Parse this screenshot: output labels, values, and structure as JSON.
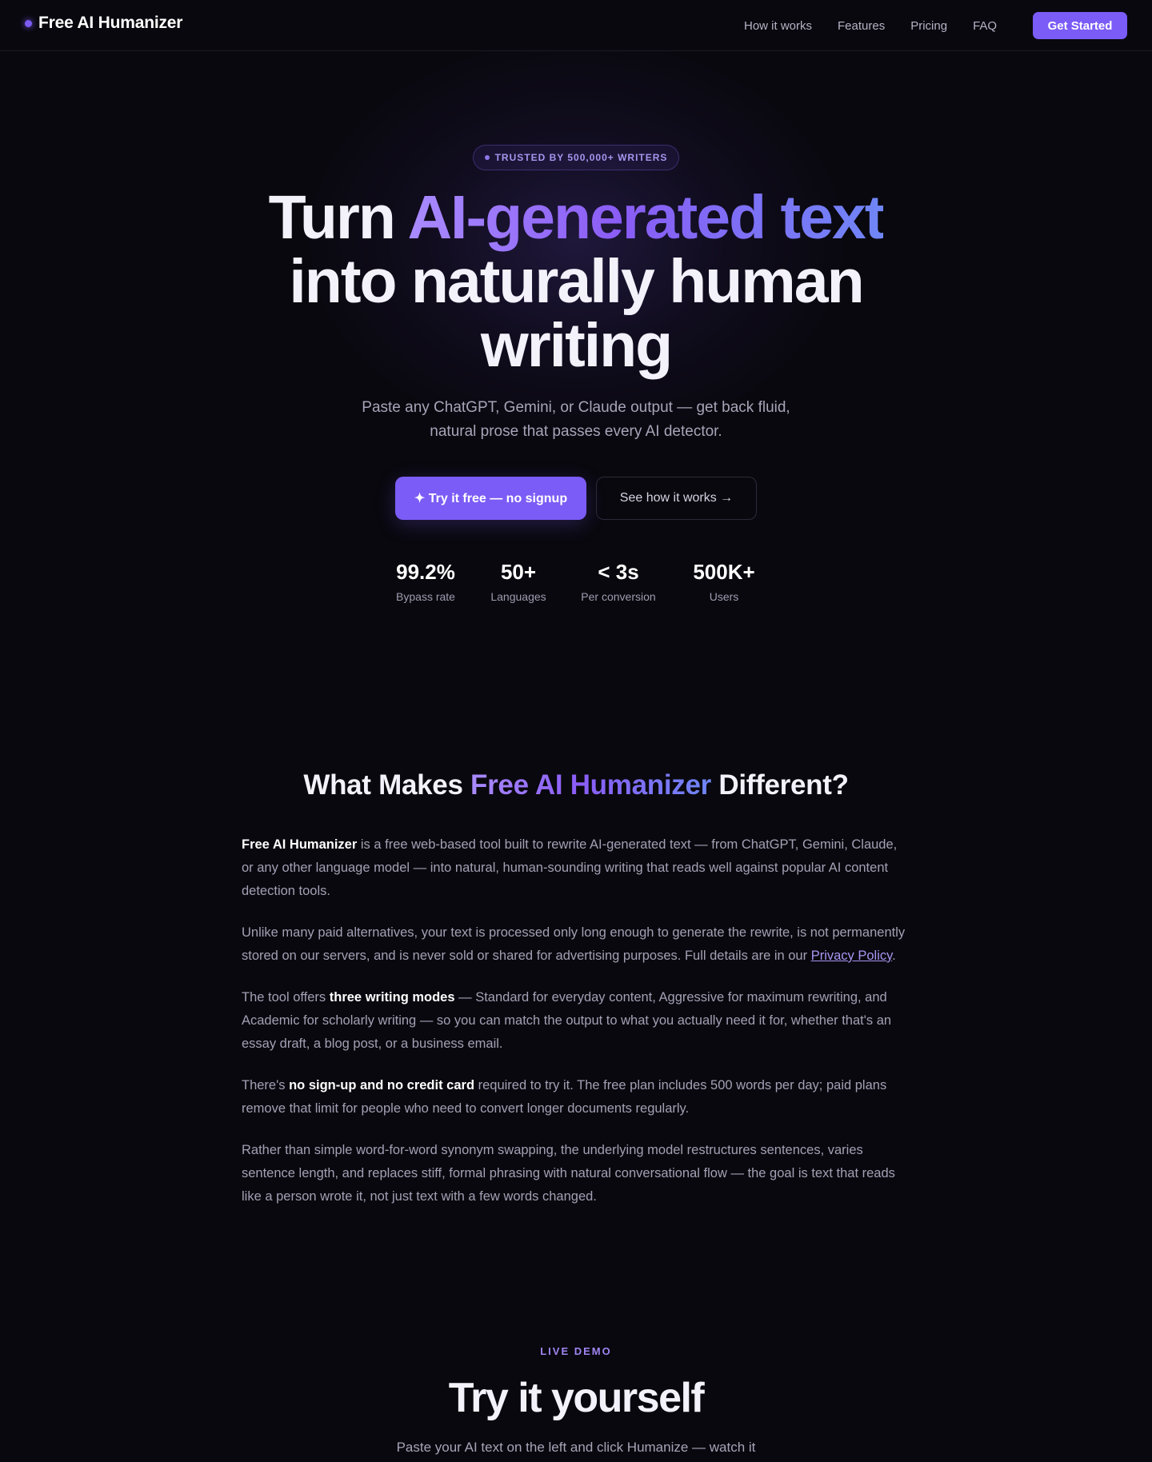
{
  "nav": {
    "brand": "Free AI Humanizer",
    "links": [
      "How it works",
      "Features",
      "Pricing",
      "FAQ"
    ],
    "cta": "Get Started"
  },
  "hero": {
    "badge": "TRUSTED BY 500,000+ WRITERS",
    "title_pre": "Turn ",
    "title_highlight": "AI-generated text",
    "title_line2": "into naturally human",
    "title_line3": "writing",
    "subtitle_line1": "Paste any ChatGPT, Gemini, or Claude output — get back fluid,",
    "subtitle_line2": "natural prose that passes every AI detector.",
    "primary_cta": "✦ Try it free — no signup",
    "secondary_cta": "See how it works →",
    "stats": [
      {
        "value": "99.2%",
        "label": "Bypass rate"
      },
      {
        "value": "50+",
        "label": "Languages"
      },
      {
        "value": "< 3s",
        "label": "Per conversion"
      },
      {
        "value": "500K+",
        "label": "Users"
      }
    ]
  },
  "about": {
    "title_pre": "What Makes ",
    "title_highlight": "Free AI Humanizer",
    "title_post": " Different?",
    "p1_bold": "Free AI Humanizer",
    "p1_rest": " is a free web-based tool built to rewrite AI-generated text — from ChatGPT, Gemini, Claude, or any other language model — into natural, human-sounding writing that reads well against popular AI content detection tools.",
    "p2_text": "Unlike many paid alternatives, your text is processed only long enough to generate the rewrite, is not permanently stored on our servers, and is never sold or shared for advertising purposes. Full details are in our ",
    "p2_link": "Privacy Policy",
    "p2_end": ".",
    "p3_pre": "The tool offers ",
    "p3_bold": "three writing modes",
    "p3_rest": " — Standard for everyday content, Aggressive for maximum rewriting, and Academic for scholarly writing — so you can match the output to what you actually need it for, whether that's an essay draft, a blog post, or a business email.",
    "p4_pre": "There's ",
    "p4_bold": "no sign-up and no credit card",
    "p4_rest": " required to try it. The free plan includes 500 words per day; paid plans remove that limit for people who need to convert longer documents regularly.",
    "p5": "Rather than simple word-for-word synonym swapping, the underlying model restructures sentences, varies sentence length, and replaces stiff, formal phrasing with natural conversational flow — the goal is text that reads like a person wrote it, not just text with a few words changed."
  },
  "demo": {
    "eyebrow": "LIVE DEMO",
    "title": "Try it yourself",
    "subtitle": "Paste your AI text on the left and click Humanize — watch it"
  },
  "colors": {
    "background": "#09080e",
    "accent": "#7b5cf6",
    "accent_light": "#a98bff",
    "accent_blue": "#6f86f6"
  }
}
